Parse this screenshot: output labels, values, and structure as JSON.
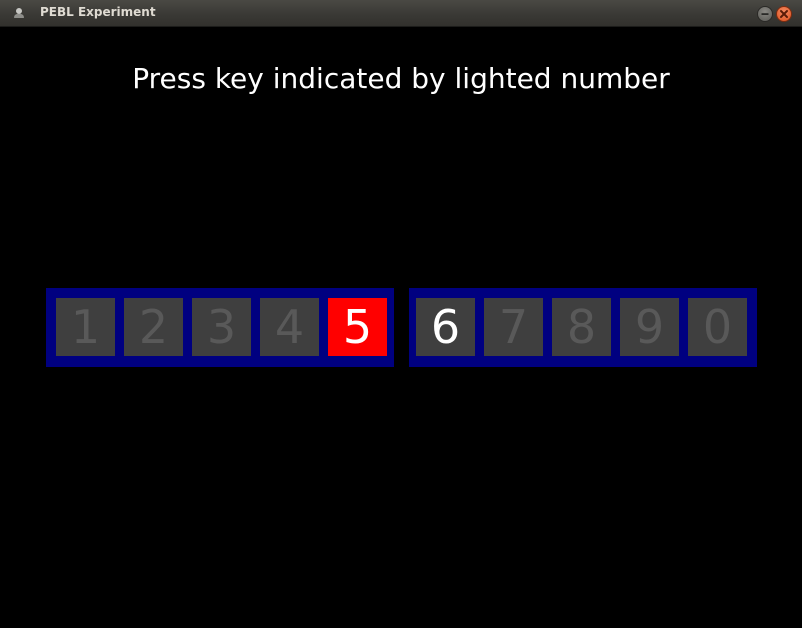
{
  "window": {
    "title": "PEBL Experiment",
    "icon": "app-icon",
    "buttons": [
      "minimize-icon",
      "close-icon"
    ]
  },
  "screen": {
    "instruction": "Press key indicated by lighted number"
  },
  "keys": {
    "left": [
      "1",
      "2",
      "3",
      "4",
      "5"
    ],
    "right": [
      "6",
      "7",
      "8",
      "9",
      "0"
    ],
    "lit_key": "5",
    "highlighted_text_key": "6"
  },
  "colors": {
    "background": "#000000",
    "panel": "#000080",
    "key_idle": "#3f3f3f",
    "key_lit": "#ff0000",
    "text": "#ffffff"
  }
}
